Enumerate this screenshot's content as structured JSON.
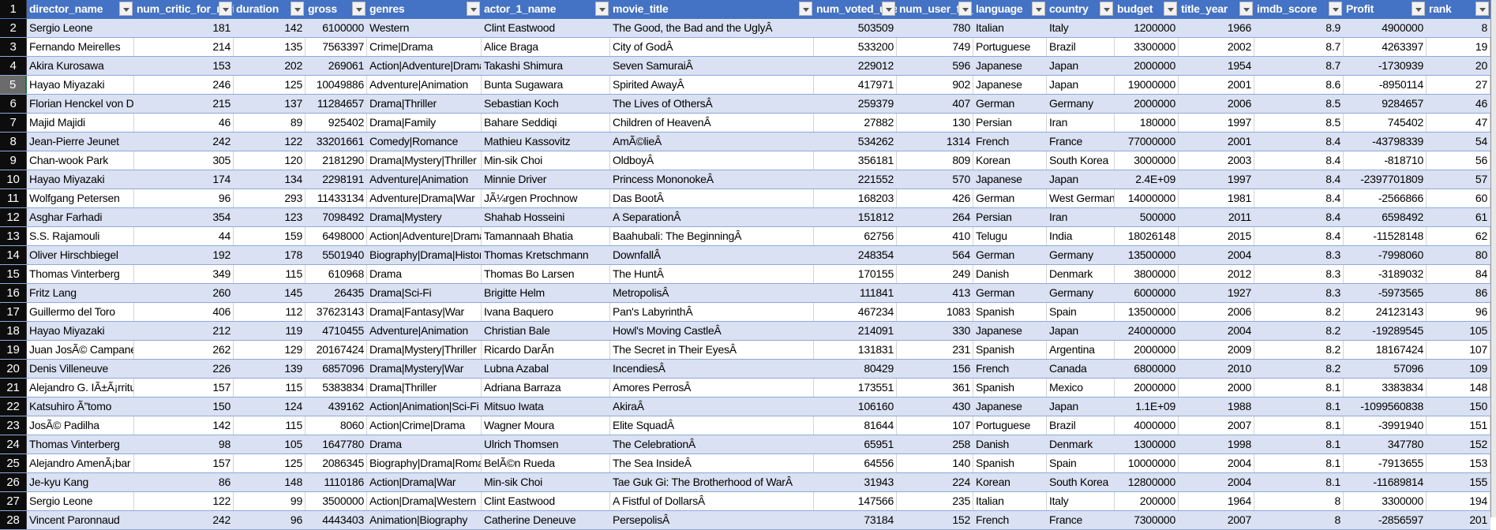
{
  "sheet": {
    "selected_row": "5",
    "colors": {
      "header_bg": "#4472C4",
      "band_bg": "#D9E1F2",
      "row_header_bg": "#0d0d0d"
    },
    "columns": [
      {
        "label": "director_name",
        "numeric": false
      },
      {
        "label": "num_critic_for_reviews",
        "numeric": true
      },
      {
        "label": "duration",
        "numeric": true
      },
      {
        "label": "gross",
        "numeric": true
      },
      {
        "label": "genres",
        "numeric": false
      },
      {
        "label": "actor_1_name",
        "numeric": false
      },
      {
        "label": "movie_title",
        "numeric": false
      },
      {
        "label": "num_voted_users",
        "numeric": true
      },
      {
        "label": "num_user_for_reviews",
        "numeric": true
      },
      {
        "label": "language",
        "numeric": false
      },
      {
        "label": "country",
        "numeric": false
      },
      {
        "label": "budget",
        "numeric": true
      },
      {
        "label": "title_year",
        "numeric": true
      },
      {
        "label": "imdb_score",
        "numeric": true
      },
      {
        "label": "Profit",
        "numeric": true
      },
      {
        "label": "rank",
        "numeric": true
      }
    ],
    "rows": [
      {
        "num": "2",
        "cells": [
          "Sergio Leone",
          "181",
          "142",
          "6100000",
          "Western",
          "Clint Eastwood",
          "The Good, the Bad and the UglyÂ",
          "503509",
          "780",
          "Italian",
          "Italy",
          "1200000",
          "1966",
          "8.9",
          "4900000",
          "8"
        ]
      },
      {
        "num": "3",
        "cells": [
          "Fernando Meirelles",
          "214",
          "135",
          "7563397",
          "Crime|Drama",
          "Alice Braga",
          "City of GodÂ",
          "533200",
          "749",
          "Portuguese",
          "Brazil",
          "3300000",
          "2002",
          "8.7",
          "4263397",
          "19"
        ]
      },
      {
        "num": "4",
        "cells": [
          "Akira Kurosawa",
          "153",
          "202",
          "269061",
          "Action|Adventure|Drama",
          "Takashi Shimura",
          "Seven SamuraiÂ",
          "229012",
          "596",
          "Japanese",
          "Japan",
          "2000000",
          "1954",
          "8.7",
          "-1730939",
          "20"
        ]
      },
      {
        "num": "5",
        "cells": [
          "Hayao Miyazaki",
          "246",
          "125",
          "10049886",
          "Adventure|Animation",
          "Bunta Sugawara",
          "Spirited AwayÂ",
          "417971",
          "902",
          "Japanese",
          "Japan",
          "19000000",
          "2001",
          "8.6",
          "-8950114",
          "27"
        ]
      },
      {
        "num": "6",
        "cells": [
          "Florian Henckel von Donnersmarck",
          "215",
          "137",
          "11284657",
          "Drama|Thriller",
          "Sebastian Koch",
          "The Lives of OthersÂ",
          "259379",
          "407",
          "German",
          "Germany",
          "2000000",
          "2006",
          "8.5",
          "9284657",
          "46"
        ]
      },
      {
        "num": "7",
        "cells": [
          "Majid Majidi",
          "46",
          "89",
          "925402",
          "Drama|Family",
          "Bahare Seddiqi",
          "Children of HeavenÂ",
          "27882",
          "130",
          "Persian",
          "Iran",
          "180000",
          "1997",
          "8.5",
          "745402",
          "47"
        ]
      },
      {
        "num": "8",
        "cells": [
          "Jean-Pierre Jeunet",
          "242",
          "122",
          "33201661",
          "Comedy|Romance",
          "Mathieu Kassovitz",
          "AmÃ©lieÂ",
          "534262",
          "1314",
          "French",
          "France",
          "77000000",
          "2001",
          "8.4",
          "-43798339",
          "54"
        ]
      },
      {
        "num": "9",
        "cells": [
          "Chan-wook Park",
          "305",
          "120",
          "2181290",
          "Drama|Mystery|Thriller",
          "Min-sik Choi",
          "OldboyÂ",
          "356181",
          "809",
          "Korean",
          "South Korea",
          "3000000",
          "2003",
          "8.4",
          "-818710",
          "56"
        ]
      },
      {
        "num": "10",
        "cells": [
          "Hayao Miyazaki",
          "174",
          "134",
          "2298191",
          "Adventure|Animation",
          "Minnie Driver",
          "Princess MononokeÂ",
          "221552",
          "570",
          "Japanese",
          "Japan",
          "2.4E+09",
          "1997",
          "8.4",
          "-2397701809",
          "57"
        ]
      },
      {
        "num": "11",
        "cells": [
          "Wolfgang Petersen",
          "96",
          "293",
          "11433134",
          "Adventure|Drama|War",
          "JÃ¼rgen Prochnow",
          "Das BootÂ",
          "168203",
          "426",
          "German",
          "West Germany",
          "14000000",
          "1981",
          "8.4",
          "-2566866",
          "60"
        ]
      },
      {
        "num": "12",
        "cells": [
          "Asghar Farhadi",
          "354",
          "123",
          "7098492",
          "Drama|Mystery",
          "Shahab Hosseini",
          "A SeparationÂ",
          "151812",
          "264",
          "Persian",
          "Iran",
          "500000",
          "2011",
          "8.4",
          "6598492",
          "61"
        ]
      },
      {
        "num": "13",
        "cells": [
          "S.S. Rajamouli",
          "44",
          "159",
          "6498000",
          "Action|Adventure|Drama",
          "Tamannaah Bhatia",
          "Baahubali: The BeginningÂ",
          "62756",
          "410",
          "Telugu",
          "India",
          "18026148",
          "2015",
          "8.4",
          "-11528148",
          "62"
        ]
      },
      {
        "num": "14",
        "cells": [
          "Oliver Hirschbiegel",
          "192",
          "178",
          "5501940",
          "Biography|Drama|History",
          "Thomas Kretschmann",
          "DownfallÂ",
          "248354",
          "564",
          "German",
          "Germany",
          "13500000",
          "2004",
          "8.3",
          "-7998060",
          "80"
        ]
      },
      {
        "num": "15",
        "cells": [
          "Thomas Vinterberg",
          "349",
          "115",
          "610968",
          "Drama",
          "Thomas Bo Larsen",
          "The HuntÂ",
          "170155",
          "249",
          "Danish",
          "Denmark",
          "3800000",
          "2012",
          "8.3",
          "-3189032",
          "84"
        ]
      },
      {
        "num": "16",
        "cells": [
          "Fritz Lang",
          "260",
          "145",
          "26435",
          "Drama|Sci-Fi",
          "Brigitte Helm",
          "MetropolisÂ",
          "111841",
          "413",
          "German",
          "Germany",
          "6000000",
          "1927",
          "8.3",
          "-5973565",
          "86"
        ]
      },
      {
        "num": "17",
        "cells": [
          "Guillermo del Toro",
          "406",
          "112",
          "37623143",
          "Drama|Fantasy|War",
          "Ivana Baquero",
          "Pan's LabyrinthÂ",
          "467234",
          "1083",
          "Spanish",
          "Spain",
          "13500000",
          "2006",
          "8.2",
          "24123143",
          "96"
        ]
      },
      {
        "num": "18",
        "cells": [
          "Hayao Miyazaki",
          "212",
          "119",
          "4710455",
          "Adventure|Animation",
          "Christian Bale",
          "Howl's Moving CastleÂ",
          "214091",
          "330",
          "Japanese",
          "Japan",
          "24000000",
          "2004",
          "8.2",
          "-19289545",
          "105"
        ]
      },
      {
        "num": "19",
        "cells": [
          "Juan JosÃ© Campanella",
          "262",
          "129",
          "20167424",
          "Drama|Mystery|Thriller",
          "Ricardo DarÃ­n",
          "The Secret in Their EyesÂ",
          "131831",
          "231",
          "Spanish",
          "Argentina",
          "2000000",
          "2009",
          "8.2",
          "18167424",
          "107"
        ]
      },
      {
        "num": "20",
        "cells": [
          "Denis Villeneuve",
          "226",
          "139",
          "6857096",
          "Drama|Mystery|War",
          "Lubna Azabal",
          "IncendiesÂ",
          "80429",
          "156",
          "French",
          "Canada",
          "6800000",
          "2010",
          "8.2",
          "57096",
          "109"
        ]
      },
      {
        "num": "21",
        "cells": [
          "Alejandro G. IÃ±Ã¡rritu",
          "157",
          "115",
          "5383834",
          "Drama|Thriller",
          "Adriana Barraza",
          "Amores PerrosÂ",
          "173551",
          "361",
          "Spanish",
          "Mexico",
          "2000000",
          "2000",
          "8.1",
          "3383834",
          "148"
        ]
      },
      {
        "num": "22",
        "cells": [
          "Katsuhiro Ã”tomo",
          "150",
          "124",
          "439162",
          "Action|Animation|Sci-Fi",
          "Mitsuo Iwata",
          "AkiraÂ",
          "106160",
          "430",
          "Japanese",
          "Japan",
          "1.1E+09",
          "1988",
          "8.1",
          "-1099560838",
          "150"
        ]
      },
      {
        "num": "23",
        "cells": [
          "JosÃ© Padilha",
          "142",
          "115",
          "8060",
          "Action|Crime|Drama",
          "Wagner Moura",
          "Elite SquadÂ",
          "81644",
          "107",
          "Portuguese",
          "Brazil",
          "4000000",
          "2007",
          "8.1",
          "-3991940",
          "151"
        ]
      },
      {
        "num": "24",
        "cells": [
          "Thomas Vinterberg",
          "98",
          "105",
          "1647780",
          "Drama",
          "Ulrich Thomsen",
          "The CelebrationÂ",
          "65951",
          "258",
          "Danish",
          "Denmark",
          "1300000",
          "1998",
          "8.1",
          "347780",
          "152"
        ]
      },
      {
        "num": "25",
        "cells": [
          "Alejandro AmenÃ¡bar",
          "157",
          "125",
          "2086345",
          "Biography|Drama|Romance",
          "BelÃ©n Rueda",
          "The Sea InsideÂ",
          "64556",
          "140",
          "Spanish",
          "Spain",
          "10000000",
          "2004",
          "8.1",
          "-7913655",
          "153"
        ]
      },
      {
        "num": "26",
        "cells": [
          "Je-kyu Kang",
          "86",
          "148",
          "1110186",
          "Action|Drama|War",
          "Min-sik Choi",
          "Tae Guk Gi: The Brotherhood of WarÂ",
          "31943",
          "224",
          "Korean",
          "South Korea",
          "12800000",
          "2004",
          "8.1",
          "-11689814",
          "155"
        ]
      },
      {
        "num": "27",
        "cells": [
          "Sergio Leone",
          "122",
          "99",
          "3500000",
          "Action|Drama|Western",
          "Clint Eastwood",
          "A Fistful of DollarsÂ",
          "147566",
          "235",
          "Italian",
          "Italy",
          "200000",
          "1964",
          "8",
          "3300000",
          "194"
        ]
      },
      {
        "num": "28",
        "cells": [
          "Vincent Paronnaud",
          "242",
          "96",
          "4443403",
          "Animation|Biography",
          "Catherine Deneuve",
          "PersepolisÂ",
          "73184",
          "152",
          "French",
          "France",
          "7300000",
          "2007",
          "8",
          "-2856597",
          "201"
        ]
      }
    ]
  }
}
